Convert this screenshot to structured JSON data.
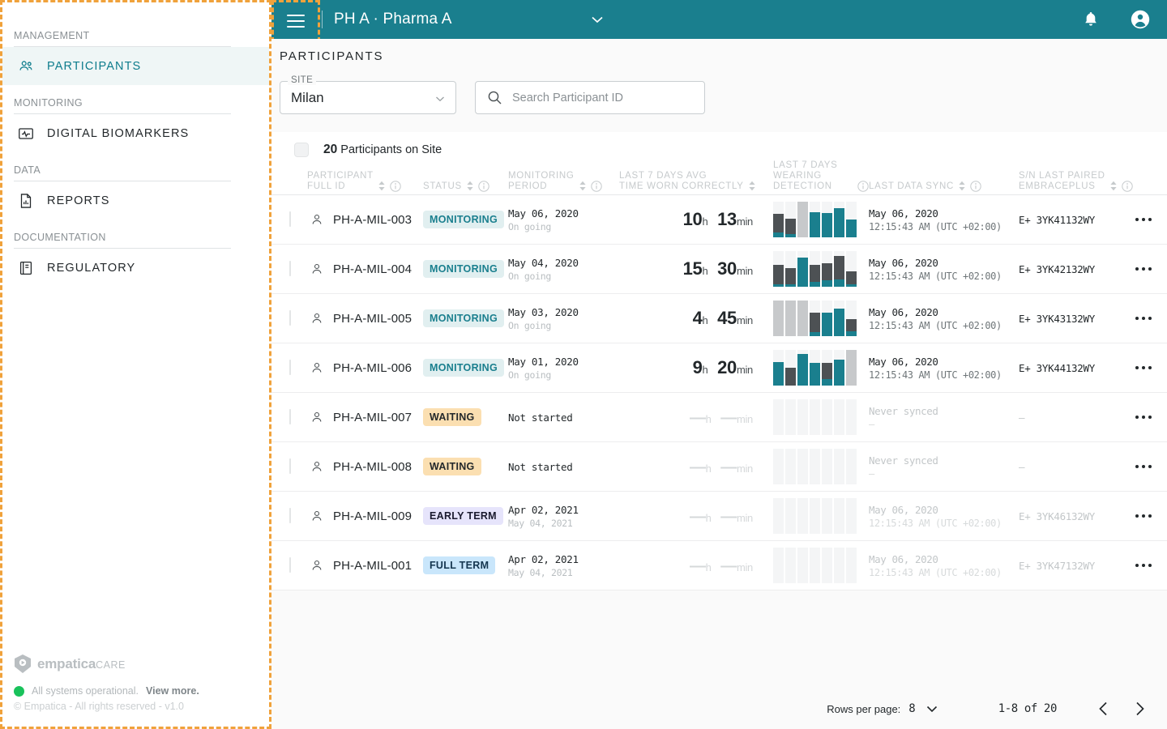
{
  "topbar": {
    "menu_icon": "hamburger-icon",
    "title": "PH A · Pharma A",
    "caret_icon": "chevron-down-icon",
    "notifications_icon": "bell-icon",
    "account_icon": "account-circle-icon"
  },
  "sidebar": {
    "groups": [
      {
        "label": "MANAGEMENT",
        "items": [
          {
            "label": "PARTICIPANTS",
            "icon": "people-icon",
            "active": true
          }
        ]
      },
      {
        "label": "MONITORING",
        "items": [
          {
            "label": "DIGITAL BIOMARKERS",
            "icon": "biomarker-chart-icon",
            "active": false
          }
        ]
      },
      {
        "label": "DATA",
        "items": [
          {
            "label": "REPORTS",
            "icon": "report-document-icon",
            "active": false
          }
        ]
      },
      {
        "label": "DOCUMENTATION",
        "items": [
          {
            "label": "REGULATORY",
            "icon": "book-icon",
            "active": false
          }
        ]
      }
    ],
    "footer": {
      "brand_name": "empatica",
      "brand_suffix": "CARE",
      "brand_icon": "empatica-shield-logo",
      "status_text": "All systems operational.",
      "status_link": "View more.",
      "status_color": "#19c25b",
      "copyright": "© Empatica - All rights reserved - v1.0"
    }
  },
  "main": {
    "page_title": "PARTICIPANTS",
    "site_filter": {
      "legend": "SITE",
      "value": "Milan",
      "caret_icon": "chevron-down-icon"
    },
    "search": {
      "placeholder": "Search Participant ID",
      "value": "",
      "icon": "search-icon"
    },
    "select_all": {
      "count": "20",
      "text": " Participants on Site"
    }
  },
  "table": {
    "columns": [
      {
        "id": "participant_full_id",
        "lines": [
          "PARTICIPANT",
          "FULL ID"
        ],
        "sortable": true,
        "info": true
      },
      {
        "id": "status",
        "lines": [
          "STATUS"
        ],
        "sortable": true,
        "info": true
      },
      {
        "id": "monitoring_period",
        "lines": [
          "MONITORING",
          "PERIOD"
        ],
        "sortable": true,
        "info": true
      },
      {
        "id": "last_7_days_avg_time_worn",
        "lines": [
          "LAST 7 DAYS AVG",
          "TIME WORN CORRECTLY"
        ],
        "sortable": true,
        "info": false
      },
      {
        "id": "last_7_days_wearing_detection",
        "lines": [
          "LAST 7 DAYS",
          "WEARING DETECTION"
        ],
        "sortable": false,
        "info": true
      },
      {
        "id": "last_data_sync",
        "lines": [
          "LAST DATA SYNC"
        ],
        "sortable": true,
        "info": true
      },
      {
        "id": "sn_last_paired",
        "lines": [
          "S/N LAST PAIRED",
          "EMBRACEPLUS"
        ],
        "sortable": true,
        "info": true
      }
    ],
    "rows": [
      {
        "id": "PH-A-MIL-003",
        "status": "MONITORING",
        "status_kind": "monitoring",
        "period_main": "May 06, 2020",
        "period_sub": "On going",
        "worn_h": "10",
        "worn_min": "13",
        "worn_empty": false,
        "bars": [
          {
            "dark": 52,
            "teal": 14
          },
          {
            "dark": 44,
            "teal": 9
          },
          {
            "nodata": true
          },
          {
            "dark": 0,
            "teal": 70
          },
          {
            "dark": 0,
            "teal": 68
          },
          {
            "dark": 0,
            "teal": 82
          },
          {
            "dark": 0,
            "teal": 50
          }
        ],
        "sync_main": "May 06, 2020",
        "sync_sub": "12:15:43 AM (UTC +02:00)",
        "sync_dim": false,
        "sn": "E+ 3YK41132WY",
        "sn_dim": false,
        "more_icon": "more-options-icon"
      },
      {
        "id": "PH-A-MIL-004",
        "status": "MONITORING",
        "status_kind": "monitoring",
        "period_main": "May 04, 2020",
        "period_sub": "On going",
        "worn_h": "15",
        "worn_min": "30",
        "worn_empty": false,
        "bars": [
          {
            "dark": 55,
            "teal": 7
          },
          {
            "dark": 45,
            "teal": 7
          },
          {
            "dark": 0,
            "teal": 82
          },
          {
            "dark": 48,
            "teal": 13
          },
          {
            "dark": 48,
            "teal": 18
          },
          {
            "dark": 66,
            "teal": 20
          },
          {
            "dark": 36,
            "teal": 7
          }
        ],
        "sync_main": "May 06, 2020",
        "sync_sub": "12:15:43 AM (UTC +02:00)",
        "sync_dim": false,
        "sn": "E+ 3YK42132WY",
        "sn_dim": false,
        "more_icon": "more-options-icon"
      },
      {
        "id": "PH-A-MIL-005",
        "status": "MONITORING",
        "status_kind": "monitoring",
        "period_main": "May 03, 2020",
        "period_sub": "On going",
        "worn_h": "4",
        "worn_min": "45",
        "worn_empty": false,
        "bars": [
          {
            "nodata": true
          },
          {
            "nodata": true
          },
          {
            "nodata": true
          },
          {
            "dark": 56,
            "teal": 11
          },
          {
            "dark": 0,
            "teal": 66
          },
          {
            "dark": 0,
            "teal": 77
          },
          {
            "dark": 34,
            "teal": 14
          }
        ],
        "sync_main": "May 06, 2020",
        "sync_sub": "12:15:43 AM (UTC +02:00)",
        "sync_dim": false,
        "sn": "E+ 3YK43132WY",
        "sn_dim": false,
        "more_icon": "more-options-icon"
      },
      {
        "id": "PH-A-MIL-006",
        "status": "MONITORING",
        "status_kind": "monitoring",
        "period_main": "May 01, 2020",
        "period_sub": "On going",
        "worn_h": "9",
        "worn_min": "20",
        "worn_empty": false,
        "bars": [
          {
            "dark": 0,
            "teal": 66
          },
          {
            "dark": 50,
            "teal": 0
          },
          {
            "dark": 0,
            "teal": 88
          },
          {
            "dark": 0,
            "teal": 63
          },
          {
            "dark": 45,
            "teal": 18
          },
          {
            "dark": 0,
            "teal": 72
          },
          {
            "nodata": true
          }
        ],
        "sync_main": "May 06, 2020",
        "sync_sub": "12:15:43 AM (UTC +02:00)",
        "sync_dim": false,
        "sn": "E+ 3YK44132WY",
        "sn_dim": false,
        "more_icon": "more-options-icon"
      },
      {
        "id": "PH-A-MIL-007",
        "status": "WAITING",
        "status_kind": "waiting",
        "period_main": "Not started",
        "period_sub": "",
        "worn_h": "—",
        "worn_min": "—",
        "worn_empty": true,
        "bars": [
          {
            "blank": true
          },
          {
            "blank": true
          },
          {
            "blank": true
          },
          {
            "blank": true
          },
          {
            "blank": true
          },
          {
            "blank": true
          },
          {
            "blank": true
          }
        ],
        "sync_main": "Never synced",
        "sync_sub": "–",
        "sync_dim": true,
        "sn": "–",
        "sn_dim": true,
        "more_icon": "more-options-icon"
      },
      {
        "id": "PH-A-MIL-008",
        "status": "WAITING",
        "status_kind": "waiting",
        "period_main": "Not started",
        "period_sub": "",
        "worn_h": "—",
        "worn_min": "—",
        "worn_empty": true,
        "bars": [
          {
            "blank": true
          },
          {
            "blank": true
          },
          {
            "blank": true
          },
          {
            "blank": true
          },
          {
            "blank": true
          },
          {
            "blank": true
          },
          {
            "blank": true
          }
        ],
        "sync_main": "Never synced",
        "sync_sub": "–",
        "sync_dim": true,
        "sn": "–",
        "sn_dim": true,
        "more_icon": "more-options-icon"
      },
      {
        "id": "PH-A-MIL-009",
        "status": "EARLY TERM",
        "status_kind": "early",
        "period_main": "Apr 02, 2021",
        "period_sub": "May 04, 2021",
        "worn_h": "—",
        "worn_min": "—",
        "worn_empty": true,
        "bars": [
          {
            "blank": true
          },
          {
            "blank": true
          },
          {
            "blank": true
          },
          {
            "blank": true
          },
          {
            "blank": true
          },
          {
            "blank": true
          },
          {
            "blank": true
          }
        ],
        "sync_main": "May 06, 2020",
        "sync_sub": "12:15:43 AM (UTC +02:00)",
        "sync_dim": true,
        "sn": "E+ 3YK46132WY",
        "sn_dim": true,
        "more_icon": "more-options-icon"
      },
      {
        "id": "PH-A-MIL-001",
        "status": "FULL TERM",
        "status_kind": "full",
        "period_main": "Apr 02, 2021",
        "period_sub": "May 04, 2021",
        "worn_h": "—",
        "worn_min": "—",
        "worn_empty": true,
        "bars": [
          {
            "blank": true
          },
          {
            "blank": true
          },
          {
            "blank": true
          },
          {
            "blank": true
          },
          {
            "blank": true
          },
          {
            "blank": true
          },
          {
            "blank": true
          }
        ],
        "sync_main": "May 06, 2020",
        "sync_sub": "12:15:43 AM (UTC +02:00)",
        "sync_dim": true,
        "sn": "E+ 3YK47132WY",
        "sn_dim": true,
        "more_icon": "more-options-icon"
      }
    ],
    "units": {
      "hour": "h",
      "minute": "min"
    }
  },
  "pagination": {
    "rows_per_page_label": "Rows per page:",
    "rows_per_page_value": "8",
    "caret_icon": "chevron-down-icon",
    "range": "1-8 of 20",
    "prev_icon": "chevron-left-icon",
    "next_icon": "chevron-right-icon"
  },
  "colors": {
    "brand_teal": "#1a7f8e",
    "accent_orange": "#F0A23B",
    "bar_dark": "#4d5154",
    "bar_teal": "#1a7f8e",
    "bar_empty": "#f4f5f6",
    "bar_nodata": "#c7c9cb"
  }
}
